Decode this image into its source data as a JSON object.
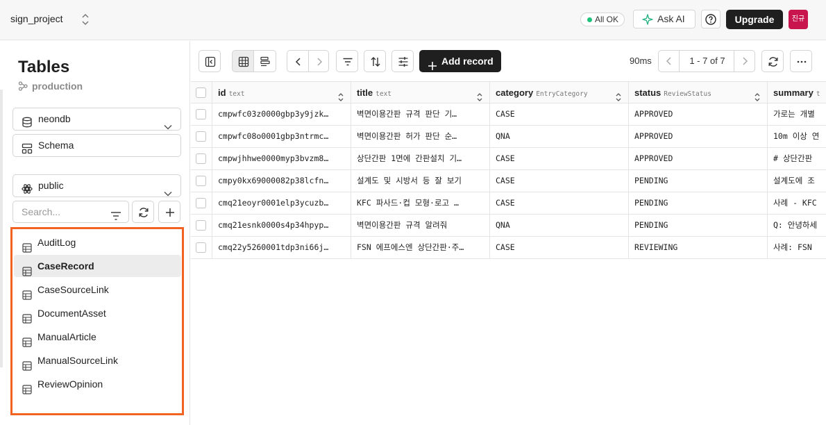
{
  "topbar": {
    "project_name": "sign_project",
    "status": "All OK",
    "ask_ai": "Ask AI",
    "upgrade": "Upgrade",
    "avatar": "진규"
  },
  "sidebar": {
    "title": "Tables",
    "branch": "production",
    "database": "neondb",
    "schema_button": "Schema",
    "schema_select": "public",
    "search_placeholder": "Search...",
    "tables": [
      {
        "name": "AuditLog",
        "active": false
      },
      {
        "name": "CaseRecord",
        "active": true
      },
      {
        "name": "CaseSourceLink",
        "active": false
      },
      {
        "name": "DocumentAsset",
        "active": false
      },
      {
        "name": "ManualArticle",
        "active": false
      },
      {
        "name": "ManualSourceLink",
        "active": false
      },
      {
        "name": "ReviewOpinion",
        "active": false
      }
    ]
  },
  "toolbar": {
    "add_record": "Add record",
    "timing": "90ms",
    "pagination": "1 - 7  of  7"
  },
  "grid": {
    "columns": [
      {
        "name": "id",
        "type": "text"
      },
      {
        "name": "title",
        "type": "text"
      },
      {
        "name": "category",
        "type": "EntryCategory"
      },
      {
        "name": "status",
        "type": "ReviewStatus"
      },
      {
        "name": "summary",
        "type": "t"
      }
    ],
    "rows": [
      [
        "cmpwfc03z0000gbp3y9jzk…",
        "벽면이용간판 규격 판단 기…",
        "CASE",
        "APPROVED",
        "가로는 개별"
      ],
      [
        "cmpwfc08o0001gbp3ntrmc…",
        "벽면이용간판 허가 판단 순…",
        "QNA",
        "APPROVED",
        "10m 이상 연"
      ],
      [
        "cmpwjhhwe0000myp3bvzm8…",
        "상단간판 1면에 간판설치 기…",
        "CASE",
        "APPROVED",
        "# 상단간판"
      ],
      [
        "cmpy0kx69000082p38lcfn…",
        "설계도 및 시방서 등 잘 보기",
        "CASE",
        "PENDING",
        "설계도에 조"
      ],
      [
        "cmq21eoyr0001elp3ycuzb…",
        "KFC 파사드·컵 모형·로고 …",
        "CASE",
        "PENDING",
        "사례 - KFC"
      ],
      [
        "cmq21esnk0000s4p34hpyp…",
        "벽면이용간판 규격 알려줘",
        "QNA",
        "PENDING",
        "Q: 안녕하세"
      ],
      [
        "cmq22y5260001tdp3ni66j…",
        "FSN 에프에스엔 상단간판·주…",
        "CASE",
        "REVIEWING",
        "사례: FSN"
      ]
    ]
  }
}
